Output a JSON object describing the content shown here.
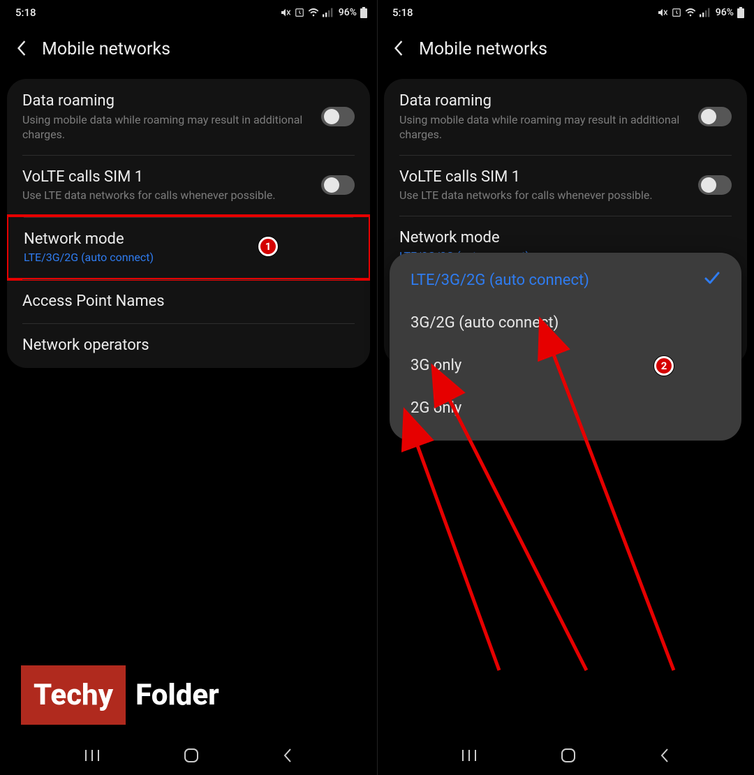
{
  "status": {
    "time": "5:18",
    "battery_pct": "96%"
  },
  "header": {
    "title": "Mobile networks"
  },
  "items": {
    "roaming": {
      "title": "Data roaming",
      "sub": "Using mobile data while roaming may result in additional charges."
    },
    "volte": {
      "title": "VoLTE calls SIM 1",
      "sub": "Use LTE data networks for calls whenever possible."
    },
    "mode": {
      "title": "Network mode",
      "sub": "LTE/3G/2G (auto connect)"
    },
    "apn": {
      "title": "Access Point Names"
    },
    "ops": {
      "title": "Network operators"
    }
  },
  "popup": {
    "opt1": "LTE/3G/2G (auto connect)",
    "opt2": "3G/2G (auto connect)",
    "opt3": "3G only",
    "opt4": "2G only"
  },
  "annotations": {
    "badge1": "1",
    "badge2": "2"
  },
  "watermark": {
    "part1": "Techy",
    "part2": "Folder"
  }
}
